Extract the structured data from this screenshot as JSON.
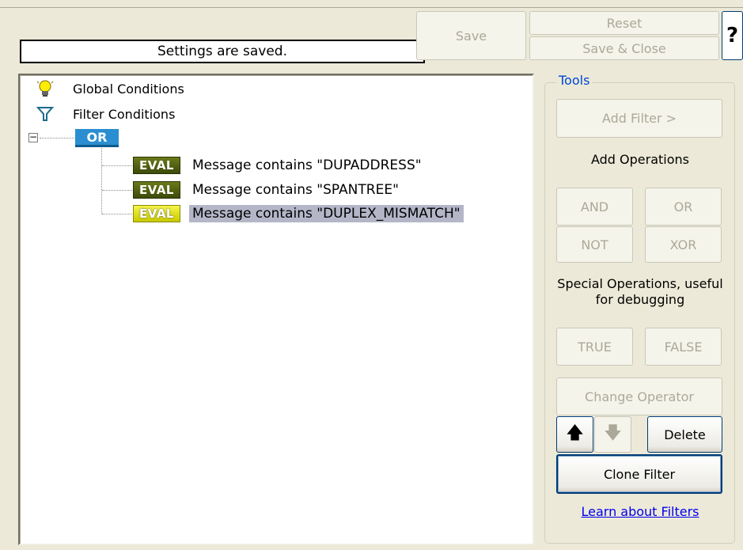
{
  "toolbar": {
    "status_text": "Settings are saved.",
    "save_label": "Save",
    "reset_label": "Reset",
    "save_close_label": "Save & Close",
    "help_label": "?"
  },
  "tree": {
    "global_conditions_label": "Global Conditions",
    "filter_conditions_label": "Filter Conditions",
    "expander_symbol": "−",
    "operator_label": "OR",
    "conditions": [
      {
        "badge": "EVAL",
        "label": "Message contains \"DUPADDRESS\"",
        "selected": false
      },
      {
        "badge": "EVAL",
        "label": "Message contains \"SPANTREE\"",
        "selected": false
      },
      {
        "badge": "EVAL",
        "label": "Message contains \"DUPLEX_MISMATCH\"",
        "selected": true
      }
    ]
  },
  "tools": {
    "group_label": "Tools",
    "add_filter_label": "Add Filter >",
    "add_operations_label": "Add Operations",
    "and_label": "AND",
    "or_label": "OR",
    "not_label": "NOT",
    "xor_label": "XOR",
    "special_operations_label": "Special Operations, useful for debugging",
    "true_label": "TRUE",
    "false_label": "FALSE",
    "change_operator_label": "Change Operator",
    "up_arrow": "🡅",
    "down_arrow": "🡇",
    "delete_label": "Delete",
    "clone_filter_label": "Clone Filter",
    "learn_link_label": "Learn about Filters"
  },
  "colors": {
    "background": "#ece9d8",
    "selection": "#b4b6c8",
    "operator_badge": "#2a8ed0",
    "eval_badge": "#4b5a12",
    "eval_badge_selected": "#e0e020",
    "link": "#0000ee",
    "tools_legend": "#0046d5"
  }
}
